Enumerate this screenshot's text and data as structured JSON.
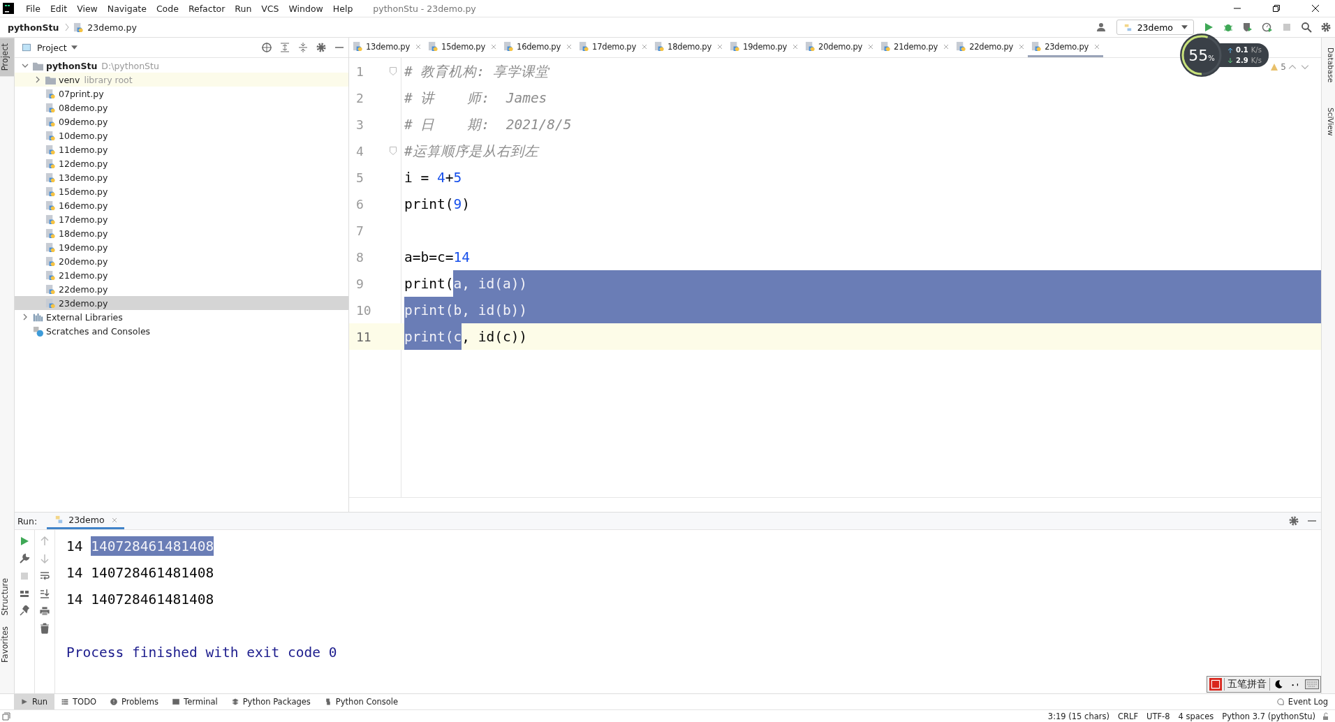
{
  "menu_bar": {
    "items": [
      "File",
      "Edit",
      "View",
      "Navigate",
      "Code",
      "Refactor",
      "Run",
      "VCS",
      "Window",
      "Help"
    ],
    "title": "pythonStu - 23demo.py"
  },
  "breadcrumb": [
    "pythonStu",
    "23demo.py"
  ],
  "toolbar": {
    "run_config": "23demo"
  },
  "left_stripe": {
    "top": [
      {
        "label": "Project",
        "selected": true
      }
    ],
    "bottom": [
      {
        "label": "Structure",
        "selected": false
      },
      {
        "label": "Favorites",
        "selected": false
      }
    ]
  },
  "right_stripe": [
    "Database",
    "SciView"
  ],
  "project_panel": {
    "title": "Project",
    "tree": [
      {
        "label": "pythonStu",
        "hint": "D:\\pythonStu",
        "kind": "folder",
        "expanded": true,
        "selected": false,
        "children": [
          {
            "label": "venv",
            "hint": "library root",
            "kind": "library_root",
            "expanded": false,
            "selected": false
          },
          {
            "label": "07print.py",
            "kind": "file",
            "selected": false
          },
          {
            "label": "08demo.py",
            "kind": "file",
            "selected": false
          },
          {
            "label": "09demo.py",
            "kind": "file",
            "selected": false
          },
          {
            "label": "10demo.py",
            "kind": "file",
            "selected": false
          },
          {
            "label": "11demo.py",
            "kind": "file",
            "selected": false
          },
          {
            "label": "12demo.py",
            "kind": "file",
            "selected": false
          },
          {
            "label": "13demo.py",
            "kind": "file",
            "selected": false
          },
          {
            "label": "15demo.py",
            "kind": "file",
            "selected": false
          },
          {
            "label": "16demo.py",
            "kind": "file",
            "selected": false
          },
          {
            "label": "17demo.py",
            "kind": "file",
            "selected": false
          },
          {
            "label": "18demo.py",
            "kind": "file",
            "selected": false
          },
          {
            "label": "19demo.py",
            "kind": "file",
            "selected": false
          },
          {
            "label": "20demo.py",
            "kind": "file",
            "selected": false
          },
          {
            "label": "21demo.py",
            "kind": "file",
            "selected": false
          },
          {
            "label": "22demo.py",
            "kind": "file",
            "selected": false
          },
          {
            "label": "23demo.py",
            "kind": "file",
            "selected": true
          }
        ]
      },
      {
        "label": "External Libraries",
        "kind": "libraries",
        "expanded": false,
        "selected": false
      },
      {
        "label": "Scratches and Consoles",
        "kind": "scratches",
        "selected": false
      }
    ]
  },
  "editor": {
    "tabs": [
      {
        "label": "13demo.py",
        "selected": false
      },
      {
        "label": "15demo.py",
        "selected": false
      },
      {
        "label": "16demo.py",
        "selected": false
      },
      {
        "label": "17demo.py",
        "selected": false
      },
      {
        "label": "18demo.py",
        "selected": false
      },
      {
        "label": "19demo.py",
        "selected": false
      },
      {
        "label": "20demo.py",
        "selected": false
      },
      {
        "label": "21demo.py",
        "selected": false
      },
      {
        "label": "22demo.py",
        "selected": false
      },
      {
        "label": "23demo.py",
        "selected": true
      }
    ],
    "warnings": "5",
    "lines": [
      {
        "number": "1",
        "fold": true,
        "current": false,
        "fill_selected": false,
        "tokens": [
          {
            "text": "# 教育机构: 享学课堂",
            "kind": "comment",
            "selected": false
          }
        ]
      },
      {
        "number": "2",
        "fold": false,
        "current": false,
        "fill_selected": false,
        "tokens": [
          {
            "text": "# 讲    师:  James",
            "kind": "comment",
            "selected": false
          }
        ]
      },
      {
        "number": "3",
        "fold": false,
        "current": false,
        "fill_selected": false,
        "tokens": [
          {
            "text": "# 日    期:  2021/8/5",
            "kind": "comment",
            "selected": false
          }
        ]
      },
      {
        "number": "4",
        "fold": true,
        "current": false,
        "fill_selected": false,
        "tokens": [
          {
            "text": "#运算顺序是从右到左",
            "kind": "comment",
            "selected": false
          }
        ]
      },
      {
        "number": "5",
        "fold": false,
        "current": false,
        "fill_selected": false,
        "tokens": [
          {
            "text": "i = ",
            "kind": "plain",
            "selected": false
          },
          {
            "text": "4",
            "kind": "number",
            "selected": false
          },
          {
            "text": "+",
            "kind": "plain",
            "selected": false
          },
          {
            "text": "5",
            "kind": "number",
            "selected": false
          }
        ]
      },
      {
        "number": "6",
        "fold": false,
        "current": false,
        "fill_selected": false,
        "tokens": [
          {
            "text": "print(",
            "kind": "plain",
            "selected": false
          },
          {
            "text": "9",
            "kind": "number",
            "selected": false
          },
          {
            "text": ")",
            "kind": "plain",
            "selected": false
          }
        ]
      },
      {
        "number": "7",
        "fold": false,
        "current": false,
        "fill_selected": false
      },
      {
        "number": "8",
        "fold": false,
        "current": false,
        "fill_selected": false,
        "tokens": [
          {
            "text": "a=b=c=",
            "kind": "plain",
            "selected": false
          },
          {
            "text": "14",
            "kind": "number",
            "selected": false
          }
        ]
      },
      {
        "number": "9",
        "fold": false,
        "current": false,
        "fill_selected": true,
        "tokens": [
          {
            "text": "print(",
            "kind": "plain",
            "selected": false
          },
          {
            "text": "a, id(a))",
            "kind": "plain",
            "selected": true
          }
        ]
      },
      {
        "number": "10",
        "fold": false,
        "current": false,
        "fill_selected": true,
        "tokens": [
          {
            "text": "print(b, id(b))",
            "kind": "plain",
            "selected": true
          }
        ]
      },
      {
        "number": "11",
        "fold": false,
        "current": true,
        "fill_selected": false,
        "tokens": [
          {
            "text": "print(c",
            "kind": "plain",
            "selected": true
          },
          {
            "text": ", id(c))",
            "kind": "plain",
            "selected": false
          }
        ]
      }
    ]
  },
  "run_panel": {
    "title": "Run:",
    "tab": {
      "label": "23demo",
      "selected": true
    },
    "output": [
      {
        "tokens": [
          {
            "text": "14 ",
            "kind": "plain",
            "selected": false
          },
          {
            "text": "140728461481408",
            "kind": "plain",
            "selected": true
          }
        ]
      },
      {
        "tokens": [
          {
            "text": "14 140728461481408",
            "kind": "plain",
            "selected": false
          }
        ]
      },
      {
        "tokens": [
          {
            "text": "14 140728461481408",
            "kind": "plain",
            "selected": false
          }
        ]
      },
      {
        "tokens": [
          {
            "text": "Process finished with exit code 0",
            "kind": "process",
            "selected": false
          }
        ]
      }
    ]
  },
  "bottom_tools": [
    {
      "label": "Run",
      "selected": true
    },
    {
      "label": "TODO",
      "selected": false
    },
    {
      "label": "Problems",
      "selected": false
    },
    {
      "label": "Terminal",
      "selected": false
    },
    {
      "label": "Python Packages",
      "selected": false
    },
    {
      "label": "Python Console",
      "selected": false
    }
  ],
  "event_log": "Event Log",
  "status_bar": [
    "3:19 (15 chars)",
    "CRLF",
    "UTF-8",
    "4 spaces",
    "Python 3.7 (pythonStu)"
  ],
  "net_monitor": {
    "percent": "55",
    "percent_unit": "%",
    "level": 0.55,
    "upload": {
      "value": "0.1",
      "unit": "K/s"
    },
    "download": {
      "value": "2.9",
      "unit": "K/s"
    }
  },
  "ime_bar": {
    "label": "五笔拼音"
  }
}
